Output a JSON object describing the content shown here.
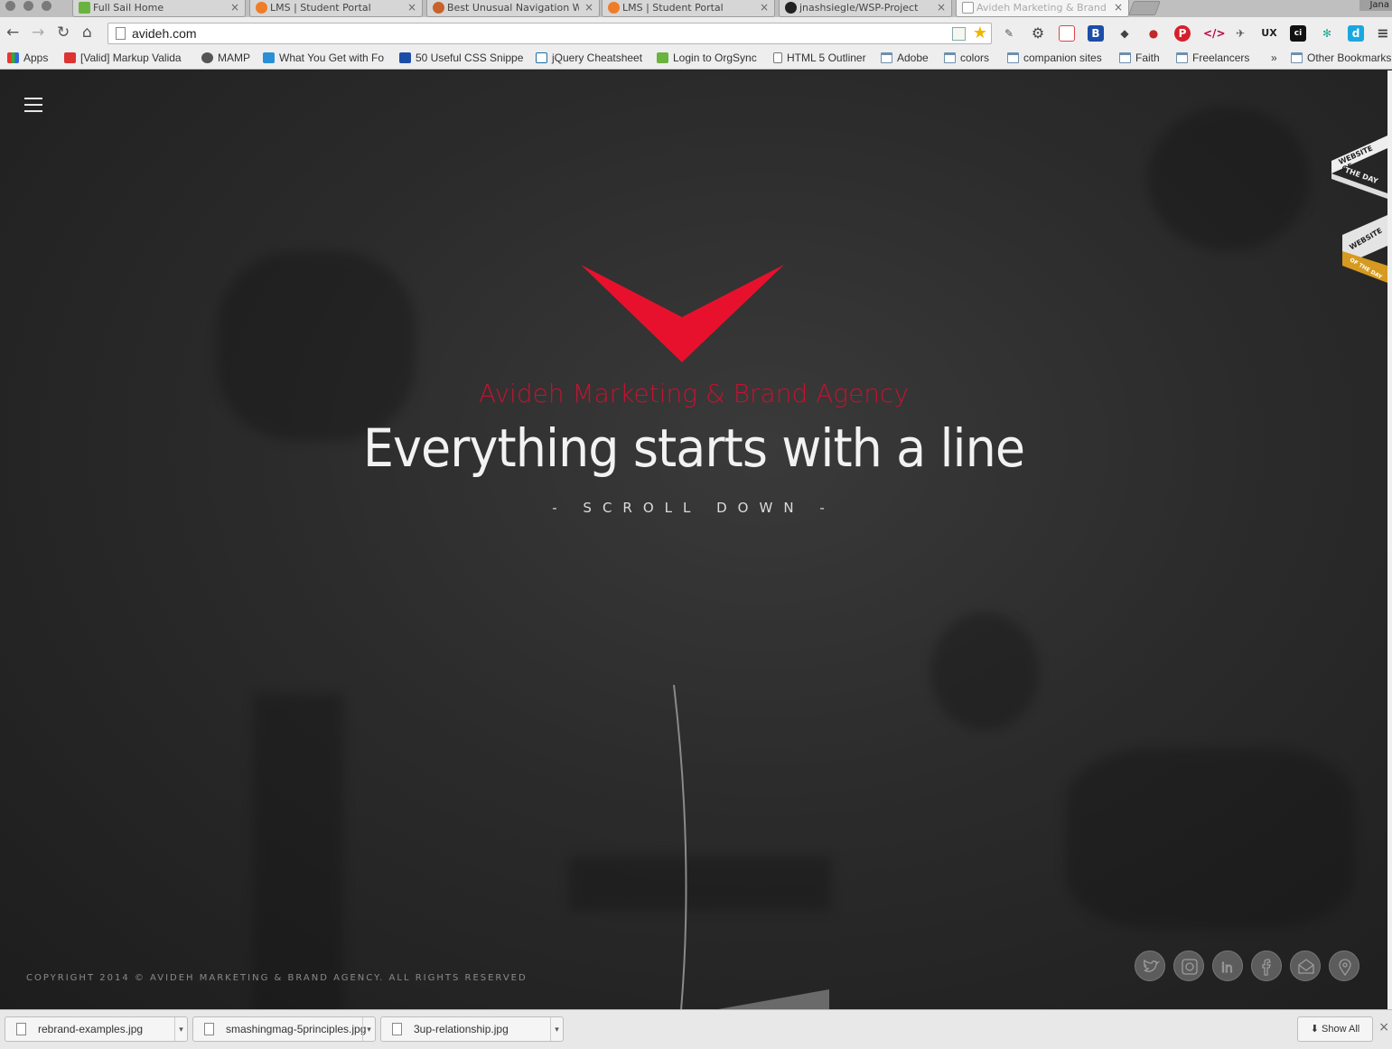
{
  "browser": {
    "tabs": [
      {
        "title": "Full Sail Home",
        "favicon_color": "#6bb33f"
      },
      {
        "title": "LMS | Student Portal",
        "favicon_color": "#f07c28"
      },
      {
        "title": "Best Unusual Navigation We",
        "favicon_color": "#c8622a"
      },
      {
        "title": "LMS | Student Portal",
        "favicon_color": "#f07c28"
      },
      {
        "title": "jnashsiegle/WSP-Project",
        "favicon_color": "#222222"
      },
      {
        "title": "Avideh Marketing & Brand",
        "favicon_color": "#ffffff",
        "active": true
      }
    ],
    "profile_name": "Jana",
    "url": "avideh.com",
    "bookmarks": [
      {
        "label": "Apps",
        "icon": "apps-grid-icon"
      },
      {
        "label": "[Valid] Markup Valida",
        "icon": "w3c-icon"
      },
      {
        "label": "MAMP",
        "icon": "mamp-icon"
      },
      {
        "label": "What You Get with Fo",
        "icon": "f-icon"
      },
      {
        "label": "50 Useful CSS Snippe",
        "icon": "h-icon"
      },
      {
        "label": "jQuery Cheatsheet",
        "icon": "jquery-icon"
      },
      {
        "label": "Login to OrgSync",
        "icon": "orgsync-icon"
      },
      {
        "label": "HTML 5 Outliner",
        "icon": "page-icon"
      },
      {
        "label": "Adobe",
        "icon": "folder-icon"
      },
      {
        "label": "colors",
        "icon": "folder-icon"
      },
      {
        "label": "companion sites",
        "icon": "folder-icon"
      },
      {
        "label": "Faith",
        "icon": "folder-icon"
      },
      {
        "label": "Freelancers",
        "icon": "folder-icon"
      }
    ],
    "bookmarks_overflow": "»",
    "other_bookmarks": "Other Bookmarks"
  },
  "page": {
    "tagline": "Avideh Marketing & Brand Agency",
    "headline": "Everything starts with a line",
    "scroll_hint": "- SCROLL DOWN -",
    "copyright": "COPYRIGHT 2014 © AVIDEH MARKETING & BRAND AGENCY. ALL RIGHTS RESERVED",
    "accent_color": "#e8112d",
    "ribbon1": {
      "top": "WEBSITE OF",
      "bottom": "THE DAY"
    },
    "ribbon2": {
      "top": "WEBSITE",
      "bottom": "OF THE DAY"
    },
    "social": [
      "twitter-icon",
      "instagram-icon",
      "linkedin-icon",
      "facebook-icon",
      "email-icon",
      "location-icon"
    ]
  },
  "downloads": {
    "files": [
      "rebrand-examples.jpg",
      "smashingmag-5principles.jpg",
      "3up-relationship.jpg"
    ],
    "show_all": "Show All"
  }
}
